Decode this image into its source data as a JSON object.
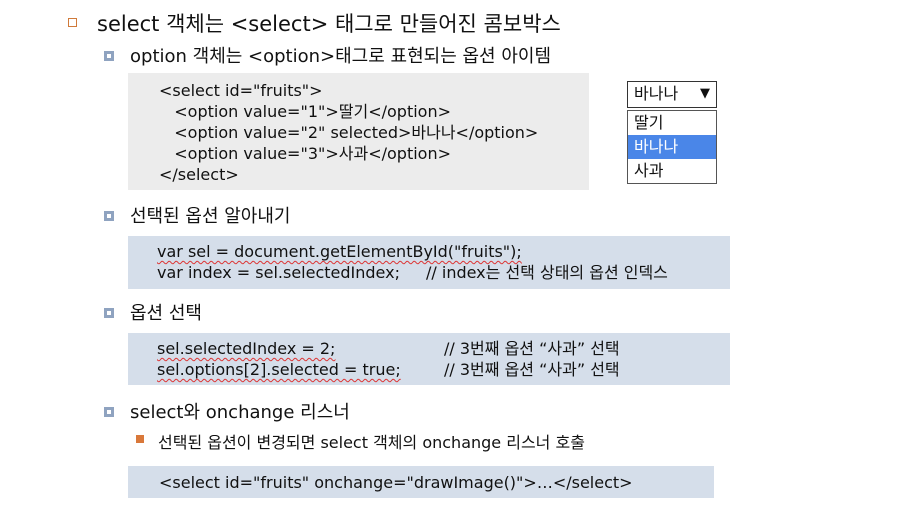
{
  "heading": "select 객체는 <select> 태그로 만들어진 콤보박스",
  "option_heading": "option 객체는 <option>태그로 표현되는 옵션 아이템",
  "code1": [
    "<select id=\"fruits\">",
    "   <option value=\"1\">딸기</option>",
    "   <option value=\"2\" selected>바나나</option>",
    "   <option value=\"3\">사과</option>",
    "</select>"
  ],
  "combobox": {
    "selected": "바나나",
    "arrow": "▼",
    "options": [
      "딸기",
      "바나나",
      "사과"
    ]
  },
  "section_get": "선택된 옵션 알아내기",
  "code2": {
    "line1": "var sel = document.getElementById(\"fruits\");",
    "line2_code": "var index = sel.selectedIndex;",
    "line2_comment": "// index는 선택 상태의 옵션 인덱스"
  },
  "section_select": "옵션 선택",
  "code3": {
    "line1_code": "sel.selectedIndex = 2;",
    "line1_comment": "// 3번째 옵션 “사과” 선택",
    "line2_code": "sel.options[2].selected = true;",
    "line2_comment": "// 3번째 옵션 “사과” 선택"
  },
  "section_onchange": "select와 onchange 리스너",
  "onchange_desc": "선택된 옵션이 변경되면 select 객체의 onchange 리스너 호출",
  "code4": "<select id=\"fruits\" onchange=\"drawImage()\">…</select>"
}
